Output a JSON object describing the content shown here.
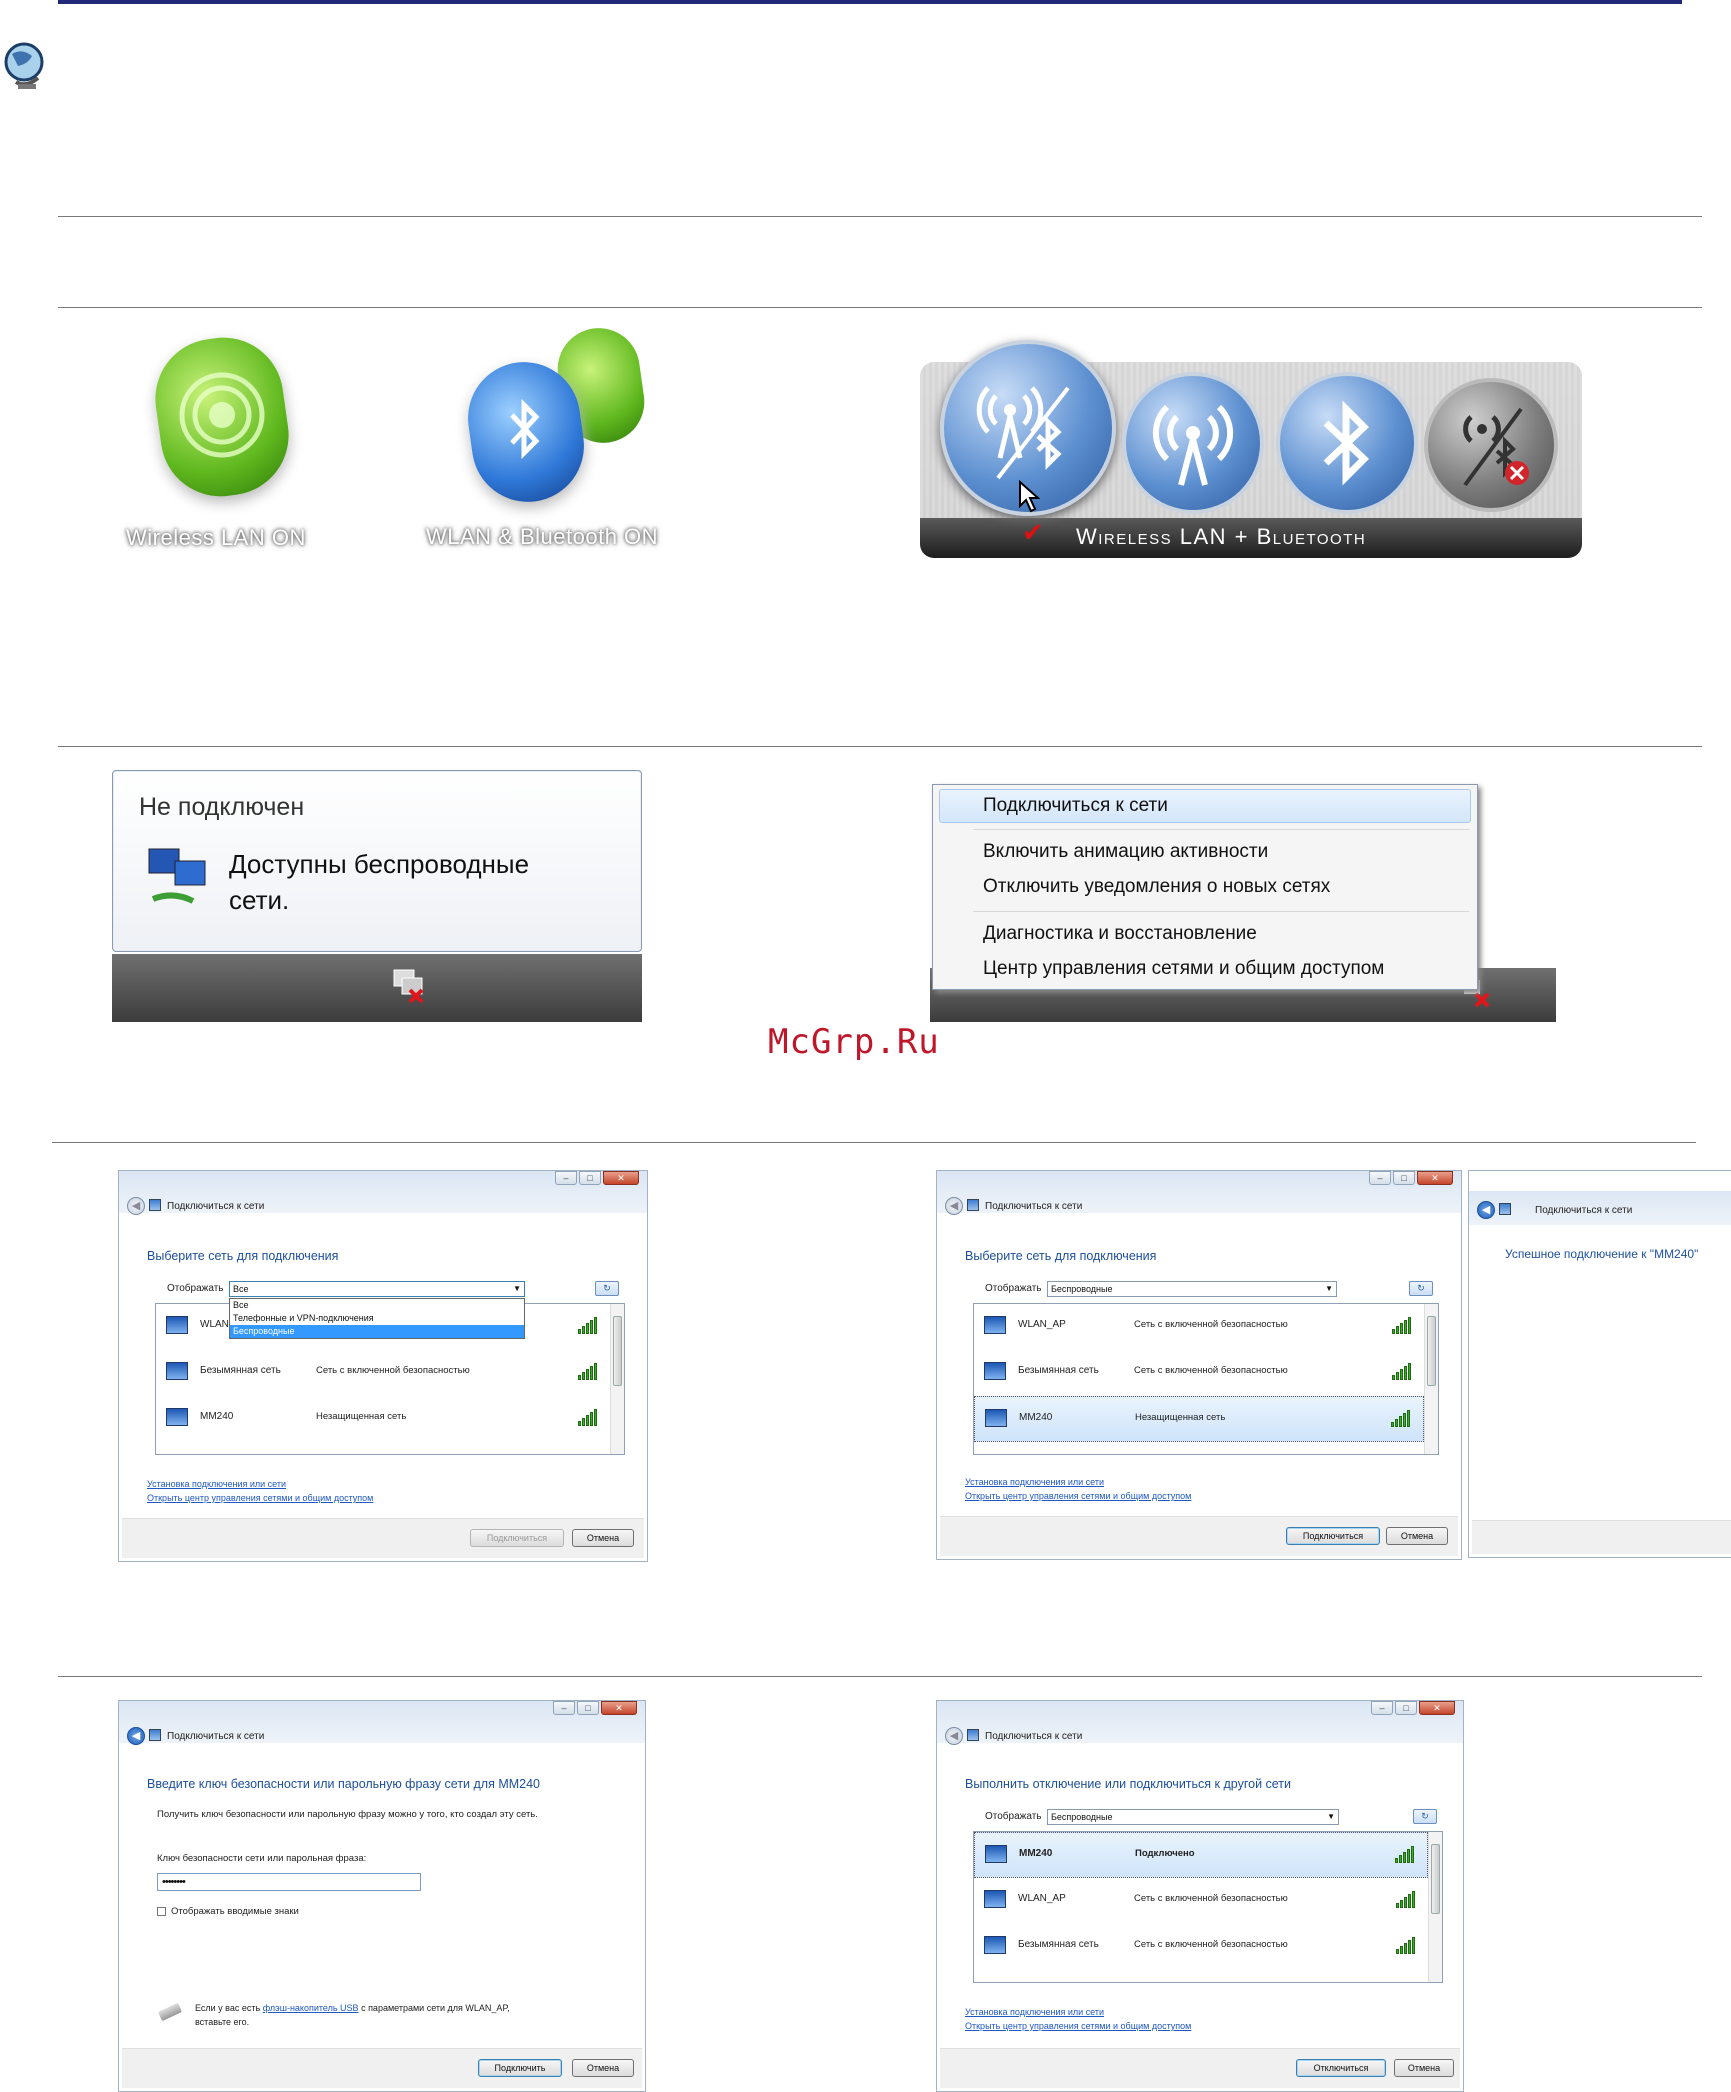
{
  "section1": {
    "caption_wlan": "Wireless LAN ON",
    "caption_both": "WLAN & Bluetooth ON",
    "panel_label": "Wireless LAN + Bluetooth"
  },
  "tray_popup": {
    "status": "Не подключен",
    "message_line1": "Доступны беспроводные",
    "message_line2": "сети."
  },
  "context_menu": {
    "items": [
      "Подключиться к сети",
      "Включить анимацию активности",
      "Отключить уведомления о новых сетях",
      "Диагностика и восстановление",
      "Центр управления сетями и общим доступом"
    ]
  },
  "watermark": "McGrp.Ru",
  "dialog1": {
    "title": "Подключиться к сети",
    "heading": "Выберите сеть для подключения",
    "show_label": "Отображать",
    "show_value": "Все",
    "dropdown_options": [
      "Все",
      "Телефонные и VPN-подключения",
      "Беспроводные"
    ],
    "networks": [
      {
        "name": "WLAN",
        "status": ""
      },
      {
        "name": "Безымянная сеть",
        "status": "Сеть с включенной безопасностью"
      },
      {
        "name": "MM240",
        "status": "Незащищенная сеть"
      }
    ],
    "link1": "Установка подключения или сети",
    "link2": "Открыть центр управления сетями и общим доступом",
    "connect": "Подключиться",
    "cancel": "Отмена"
  },
  "dialog2": {
    "title": "Подключиться к сети",
    "heading": "Выберите сеть для подключения",
    "show_label": "Отображать",
    "show_value": "Беспроводные",
    "networks": [
      {
        "name": "WLAN_AP",
        "status": "Сеть с включенной безопасностью"
      },
      {
        "name": "Безымянная сеть",
        "status": "Сеть с включенной безопасностью"
      },
      {
        "name": "MM240",
        "status": "Незащищенная сеть"
      }
    ],
    "link1": "Установка подключения или сети",
    "link2": "Открыть центр управления сетями и общим доступом",
    "connect": "Подключиться",
    "cancel": "Отмена"
  },
  "dialog3": {
    "title": "Подключиться к сети",
    "message": "Успешное подключение к \"MM240\""
  },
  "dialog4": {
    "title": "Подключиться к сети",
    "heading": "Введите ключ безопасности или парольную фразу сети для MM240",
    "info": "Получить ключ безопасности или парольную фразу можно у того, кто создал эту сеть.",
    "key_label": "Ключ безопасности сети или парольная фраза:",
    "key_value": "••••••••",
    "show_chars": "Отображать вводимые знаки",
    "usb_pre": "Если у вас есть ",
    "usb_link": "флэш-накопитель USB",
    "usb_post": " с параметрами сети для WLAN_AP,",
    "usb_line2": "вставьте его.",
    "connect": "Подключить",
    "cancel": "Отмена"
  },
  "dialog5": {
    "title": "Подключиться к сети",
    "heading": "Выполнить отключение или подключиться к другой сети",
    "show_label": "Отображать",
    "show_value": "Беспроводные",
    "networks": [
      {
        "name": "MM240",
        "status": "Подключено"
      },
      {
        "name": "WLAN_AP",
        "status": "Сеть с включенной безопасностью"
      },
      {
        "name": "Безымянная сеть",
        "status": "Сеть с включенной безопасностью"
      }
    ],
    "link1": "Установка подключения или сети",
    "link2": "Открыть центр управления сетями и общим доступом",
    "disconnect": "Отключиться",
    "cancel": "Отмена"
  }
}
